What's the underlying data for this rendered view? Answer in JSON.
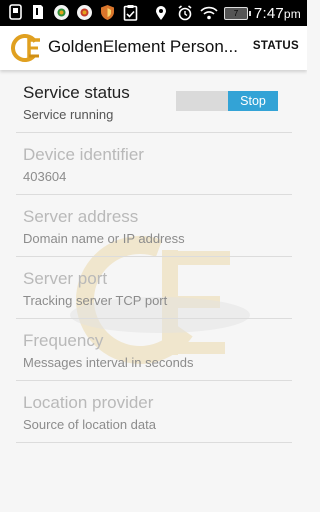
{
  "status_bar": {
    "time": "7:47",
    "time_suffix": "pm",
    "battery_level": "7",
    "icons": [
      "sim-card-icon",
      "sd-card-icon",
      "badge-icon",
      "badge-icon",
      "shield-icon",
      "clipboard-icon",
      "location-icon",
      "alarm-icon",
      "wifi-icon",
      "battery-icon"
    ]
  },
  "app_bar": {
    "title": "GoldenElement Person...",
    "action_label": "STATUS",
    "logo_text": "GE"
  },
  "prefs": [
    {
      "title": "Service status",
      "summary": "Service running",
      "enabled": true
    },
    {
      "title": "Device identifier",
      "summary": "403604",
      "enabled": false
    },
    {
      "title": "Server address",
      "summary": "Domain name or IP address",
      "enabled": false
    },
    {
      "title": "Server port",
      "summary": "Tracking server TCP port",
      "enabled": false
    },
    {
      "title": "Frequency",
      "summary": "Messages interval in seconds",
      "enabled": false
    },
    {
      "title": "Location provider",
      "summary": "Source of location data",
      "enabled": false
    }
  ],
  "service_toggle": {
    "label": "Stop",
    "on": true
  },
  "colors": {
    "accent": "#33a3d6",
    "logo_gold": "#e0a020",
    "background": "#f6f6f6"
  }
}
